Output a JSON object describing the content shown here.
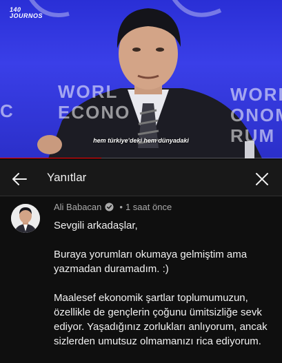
{
  "video": {
    "channel_logo": "140\nJOURNOS",
    "caption": "hem türkiye'deki hem dünyadaki",
    "progress": 0.36,
    "wef_left": "WORL\nECONO",
    "wef_right": "WORL\nONOM\nRUM",
    "wef_far_left": "C"
  },
  "header": {
    "title": "Yanıtlar",
    "back_icon": "arrow-left-icon",
    "close_icon": "close-icon"
  },
  "comment": {
    "author": "Ali Babacan",
    "verified": true,
    "separator": "•",
    "time": "1 saat önce",
    "paragraphs": [
      "Sevgili arkadaşlar,",
      "Buraya yorumları okumaya gelmiştim ama yazmadan duramadım. :)",
      "Maalesef ekonomik şartlar toplumumuzun, özellikle de gençlerin çoğunu ümitsizliğe sevk ediyor. Yaşadığınız zorlukları anlıyorum, ancak sizlerden umutsuz olmamanızı rica ediyorum."
    ]
  },
  "colors": {
    "background": "#0f0f0f",
    "header_bg": "#181818",
    "progress": "#ff0000",
    "stage_blue": "#3a3fe8"
  }
}
